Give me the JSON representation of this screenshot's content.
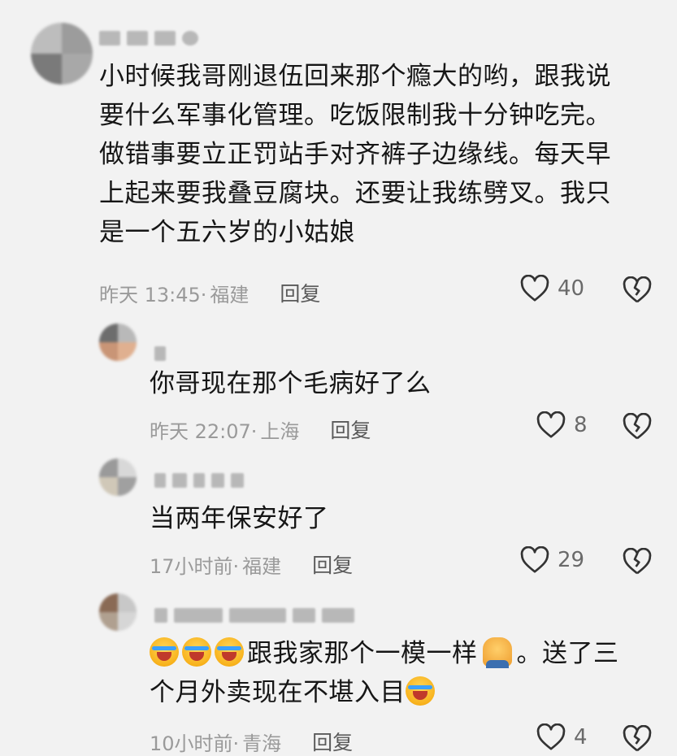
{
  "comments": [
    {
      "username": "",
      "text_lines": [
        "小时候我哥刚退伍回来那个瘾大的哟，跟我说",
        "要什么军事化管理。吃饭限制我十分钟吃完。",
        "做错事要立正罚站手对齐裤子边缘线。每天早",
        "上起来要我叠豆腐块。还要让我练劈叉。我只",
        "是一个五六岁的小姑娘"
      ],
      "time": "昨天 13:45·",
      "location": "福建",
      "reply_label": "回复",
      "like_count": "40"
    },
    {
      "username": "",
      "text_lines": [
        "你哥现在那个毛病好了么"
      ],
      "time": "昨天 22:07·",
      "location": "上海",
      "reply_label": "回复",
      "like_count": "8"
    },
    {
      "username": "",
      "text_lines": [
        "当两年保安好了"
      ],
      "time": "17小时前·",
      "location": "福建",
      "reply_label": "回复",
      "like_count": "29"
    },
    {
      "username": "",
      "text_lines_rich": {
        "line1_text": "跟我家那个一模一样",
        "line1_tail": "。送了三",
        "line2_text": "个月外卖现在不堪入目"
      },
      "time": "10小时前·",
      "location": "青海",
      "reply_label": "回复",
      "like_count": "4"
    }
  ],
  "icons": {
    "like": "heart-outline-icon",
    "dislike": "broken-heart-icon",
    "emoji": "laughing-crying-emoji",
    "facepalm": "facepalm-emoji"
  },
  "colors": {
    "text": "#161616",
    "meta": "#9a9a9a",
    "reply": "#5a5a5a",
    "background": "#f2f2f2"
  }
}
